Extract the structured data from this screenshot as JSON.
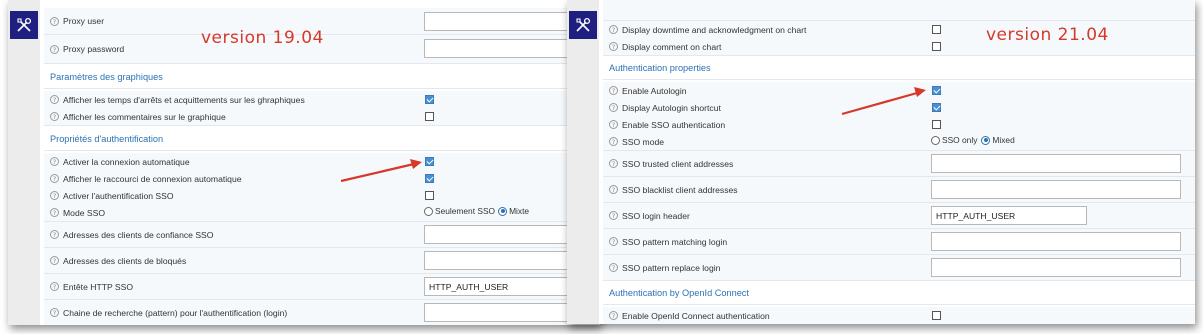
{
  "colors": {
    "section_title": "#2a72b5",
    "version_text": "#d6382b",
    "arrow": "#d6382b",
    "logo_tile": "#1f1f82",
    "checkbox_checked": "#4a90d0"
  },
  "help_glyph": "?",
  "left": {
    "version_label": "version 19.04",
    "rows_top": [
      {
        "label": "Proxy user"
      },
      {
        "label": "Proxy password"
      }
    ],
    "section_graphs": "Paramètres des graphiques",
    "graph_rows": [
      {
        "label": "Afficher les temps d'arrêts et acquittements sur les ghraphiques",
        "checked": true
      },
      {
        "label": "Afficher les commentaires sur le graphique",
        "checked": false
      }
    ],
    "section_auth": "Propriétés d'authentification",
    "auth_rows": [
      {
        "label": "Activer la connexion automatique",
        "checked": true
      },
      {
        "label": "Afficher le raccourci de connexion automatique",
        "checked": true
      },
      {
        "label": "Activer l'authentification SSO",
        "checked": false
      }
    ],
    "sso_mode": {
      "label": "Mode SSO",
      "option_1": "Seulement SSO",
      "option_2": "Mixte",
      "selected": "Mixte"
    },
    "text_rows": [
      {
        "label": "Adresses des clients de confiance SSO",
        "value": ""
      },
      {
        "label": "Adresses des clients de bloqués",
        "value": ""
      },
      {
        "label": "Entête HTTP SSO",
        "value": "HTTP_AUTH_USER"
      },
      {
        "label": "Chaine de recherche (pattern) pour l'authentification (login)",
        "value": ""
      }
    ]
  },
  "right": {
    "version_label": "version 21.04",
    "top_rows": [
      {
        "label": "Display downtime and acknowledgment on chart",
        "checked": false
      },
      {
        "label": "Display comment on chart",
        "checked": false
      }
    ],
    "section_auth": "Authentication properties",
    "auth_rows": [
      {
        "label": "Enable Autologin",
        "checked": true
      },
      {
        "label": "Display Autologin shortcut",
        "checked": true
      },
      {
        "label": "Enable SSO authentication",
        "checked": false
      }
    ],
    "sso_mode": {
      "label": "SSO mode",
      "option_1": "SSO only",
      "option_2": "Mixed",
      "selected": "Mixed"
    },
    "text_rows": [
      {
        "label": "SSO trusted client addresses",
        "value": ""
      },
      {
        "label": "SSO blacklist client addresses",
        "value": ""
      },
      {
        "label": "SSO login header",
        "value": "HTTP_AUTH_USER"
      },
      {
        "label": "SSO pattern matching login",
        "value": ""
      },
      {
        "label": "SSO pattern replace login",
        "value": ""
      }
    ],
    "section_openid": "Authentication by OpenId Connect",
    "openid_rows": [
      {
        "label": "Enable OpenId Connect authentication",
        "checked": false
      }
    ]
  }
}
